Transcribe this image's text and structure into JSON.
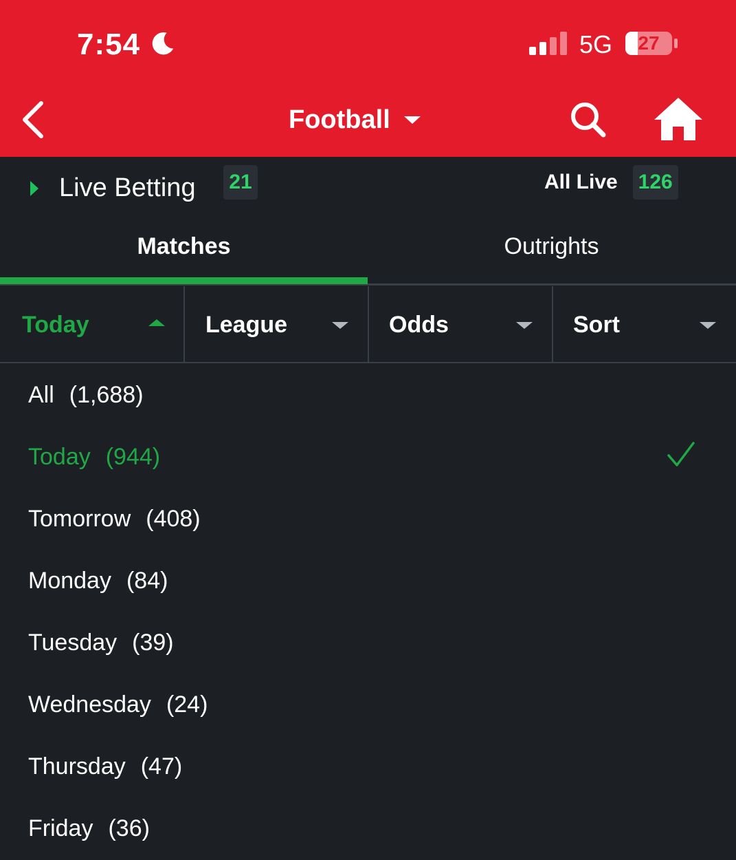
{
  "status_bar": {
    "time": "7:54",
    "network": "5G",
    "battery": "27",
    "battery_level": 0.27
  },
  "header": {
    "title": "Football"
  },
  "live": {
    "label": "Live Betting",
    "count": "21",
    "all_live_label": "All Live",
    "all_live_count": "126"
  },
  "tabs": [
    {
      "label": "Matches",
      "active": true
    },
    {
      "label": "Outrights",
      "active": false
    }
  ],
  "filters": [
    {
      "label": "Today",
      "open": true
    },
    {
      "label": "League",
      "open": false
    },
    {
      "label": "Odds",
      "open": false
    },
    {
      "label": "Sort",
      "open": false
    }
  ],
  "options": [
    {
      "label": "All",
      "count": "(1,688)"
    },
    {
      "label": "Today",
      "count": "(944)",
      "selected": true
    },
    {
      "label": "Tomorrow",
      "count": "(408)"
    },
    {
      "label": "Monday",
      "count": "(84)"
    },
    {
      "label": "Tuesday",
      "count": "(39)"
    },
    {
      "label": "Wednesday",
      "count": "(24)"
    },
    {
      "label": "Thursday",
      "count": "(47)"
    },
    {
      "label": "Friday",
      "count": "(36)"
    }
  ],
  "colors": {
    "header_red": "#e31b2a",
    "accent_green": "#1fa845",
    "background": "#1c1f24"
  }
}
